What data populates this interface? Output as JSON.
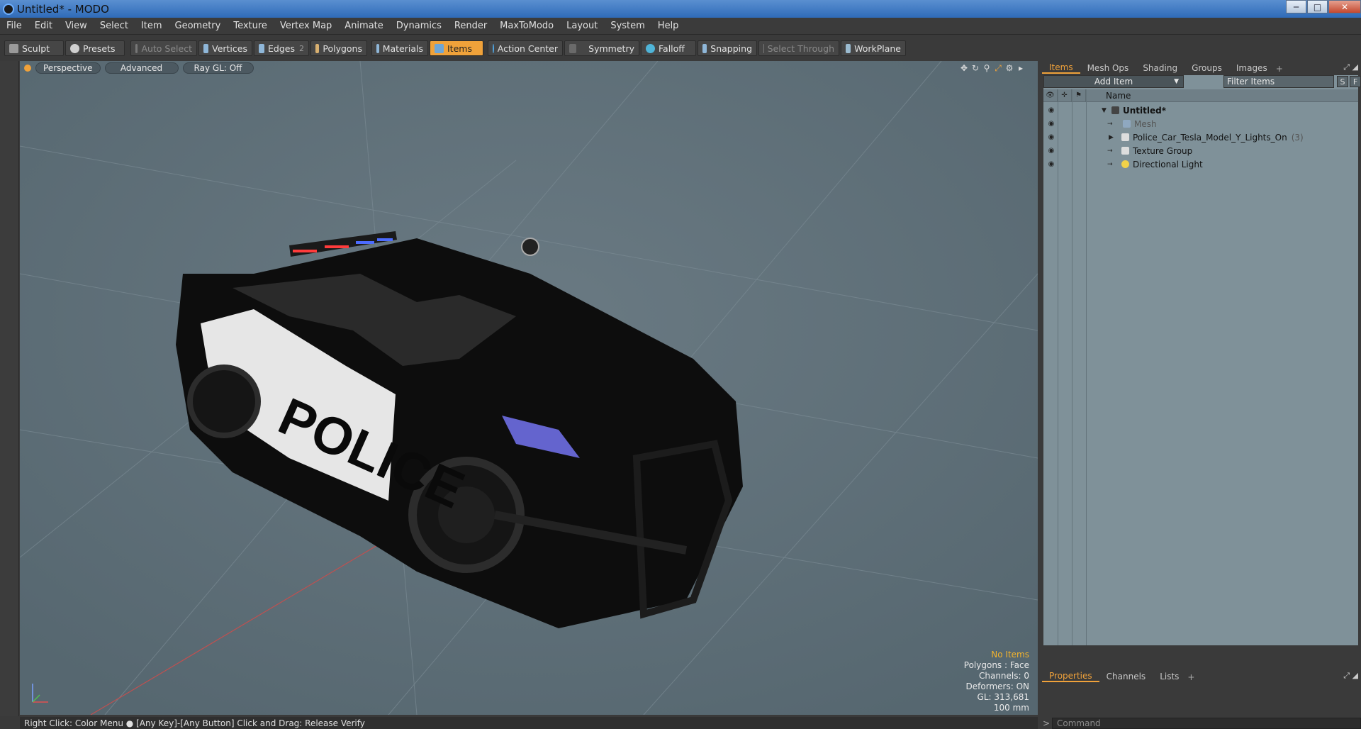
{
  "window": {
    "title": "Untitled* - MODO",
    "minimize": "─",
    "maximize": "□",
    "close": "✕"
  },
  "menu": [
    "File",
    "Edit",
    "View",
    "Select",
    "Item",
    "Geometry",
    "Texture",
    "Vertex Map",
    "Animate",
    "Dynamics",
    "Render",
    "MaxToModo",
    "Layout",
    "System",
    "Help"
  ],
  "toolbar": {
    "sculpt": "Sculpt",
    "presets": "Presets",
    "auto_select": "Auto Select",
    "vertices": "Vertices",
    "edges": "Edges",
    "edges_count": "2",
    "polygons": "Polygons",
    "materials": "Materials",
    "items": "Items",
    "action_center": "Action Center",
    "symmetry": "Symmetry",
    "falloff": "Falloff",
    "snapping": "Snapping",
    "select_through": "Select Through",
    "workplane": "WorkPlane"
  },
  "viewport": {
    "tabs": [
      "Perspective",
      "Advanced",
      "Ray GL: Off"
    ],
    "hud": {
      "selection": "No Items",
      "polygons": "Polygons : Face",
      "channels": "Channels: 0",
      "deformers": "Deformers: ON",
      "gl": "GL: 313,681",
      "size": "100 mm"
    },
    "decal_text": "POLICE"
  },
  "status": "Right Click: Color Menu ● [Any Key]-[Any Button] Click and Drag: Release Verify",
  "items_panel": {
    "tabs": [
      "Items",
      "Mesh Ops",
      "Shading",
      "Groups",
      "Images"
    ],
    "add_item": "Add Item",
    "filter_placeholder": "Filter Items",
    "btn_s": "S",
    "btn_f": "F",
    "column_name": "Name",
    "rows": [
      {
        "label": "Untitled*",
        "count": ""
      },
      {
        "label": "Mesh",
        "count": ""
      },
      {
        "label": "Police_Car_Tesla_Model_Y_Lights_On",
        "count": "(3)"
      },
      {
        "label": "Texture Group",
        "count": ""
      },
      {
        "label": "Directional Light",
        "count": ""
      }
    ]
  },
  "properties_panel": {
    "tabs": [
      "Properties",
      "Channels",
      "Lists"
    ]
  },
  "command": {
    "placeholder": "Command"
  }
}
